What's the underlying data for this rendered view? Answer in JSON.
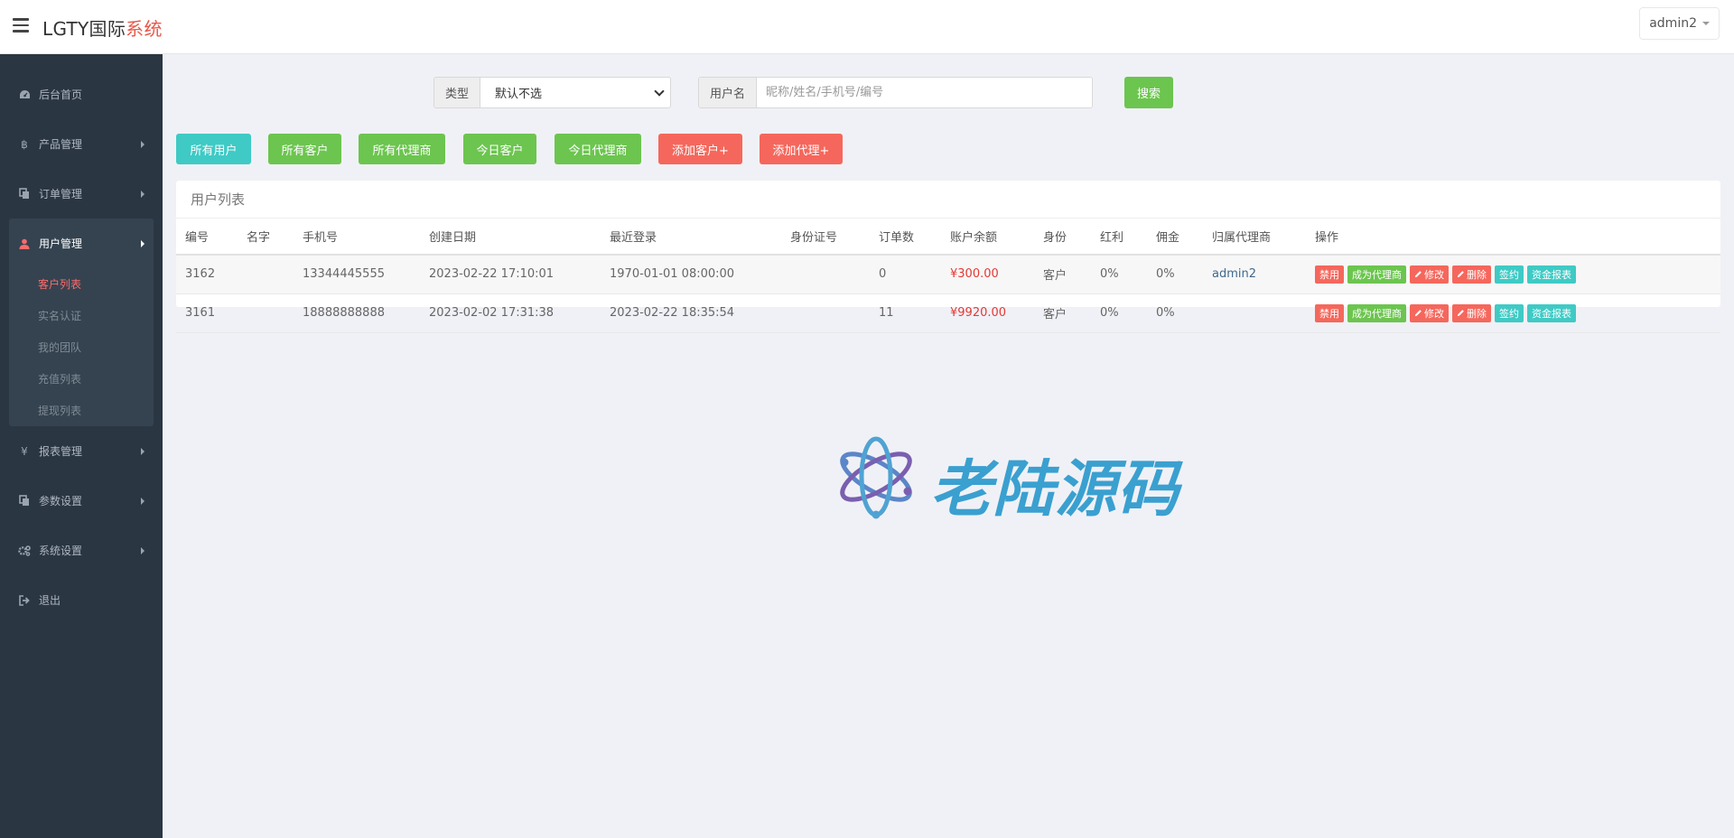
{
  "header": {
    "brand_main": "LGTY国际",
    "brand_accent": "系统",
    "user": "admin2"
  },
  "sidebar": {
    "items": [
      {
        "label": "后台首页",
        "icon": "dashboard-icon"
      },
      {
        "label": "产品管理",
        "icon": "bitcoin-icon"
      },
      {
        "label": "订单管理",
        "icon": "copy-icon"
      },
      {
        "label": "用户管理",
        "icon": "user-icon"
      },
      {
        "label": "报表管理",
        "icon": "yen-icon"
      },
      {
        "label": "参数设置",
        "icon": "copy-icon"
      },
      {
        "label": "系统设置",
        "icon": "gears-icon"
      },
      {
        "label": "退出",
        "icon": "sign-out-icon"
      }
    ],
    "user_sub": [
      "客户列表",
      "实名认证",
      "我的团队",
      "充值列表",
      "提现列表"
    ]
  },
  "filters": {
    "type_label": "类型",
    "type_value": "默认不选",
    "username_label": "用户名",
    "username_placeholder": "昵称/姓名/手机号/编号",
    "search_label": "搜索"
  },
  "actions": [
    "所有用户",
    "所有客户",
    "所有代理商",
    "今日客户",
    "今日代理商",
    "添加客户+",
    "添加代理+"
  ],
  "table": {
    "title": "用户列表",
    "headers": [
      "编号",
      "名字",
      "手机号",
      "创建日期",
      "最近登录",
      "身份证号",
      "订单数",
      "账户余额",
      "身份",
      "红利",
      "佣金",
      "归属代理商",
      "操作"
    ],
    "rows": [
      {
        "id": "3162",
        "name": "",
        "phone": "13344445555",
        "created": "2023-02-22 17:10:01",
        "last_login": "1970-01-01 08:00:00",
        "id_card": "",
        "orders": "0",
        "balance": "¥300.00",
        "role": "客户",
        "bonus": "0%",
        "commission": "0%",
        "agent": "admin2"
      },
      {
        "id": "3161",
        "name": "",
        "phone": "18888888888",
        "created": "2023-02-02 17:31:38",
        "last_login": "2023-02-22 18:35:54",
        "id_card": "",
        "orders": "11",
        "balance": "¥9920.00",
        "role": "客户",
        "bonus": "0%",
        "commission": "0%",
        "agent": ""
      }
    ],
    "ops": [
      "禁用",
      "成为代理商",
      "修改",
      "删除",
      "签约",
      "资金报表"
    ]
  },
  "watermark": {
    "text": "老陆源码"
  },
  "colors": {
    "sidebar_bg": "#2b3643",
    "accent_red": "#f5675c",
    "accent_green": "#6cc54f",
    "accent_cyan": "#3fcac5",
    "money": "#e53935"
  }
}
